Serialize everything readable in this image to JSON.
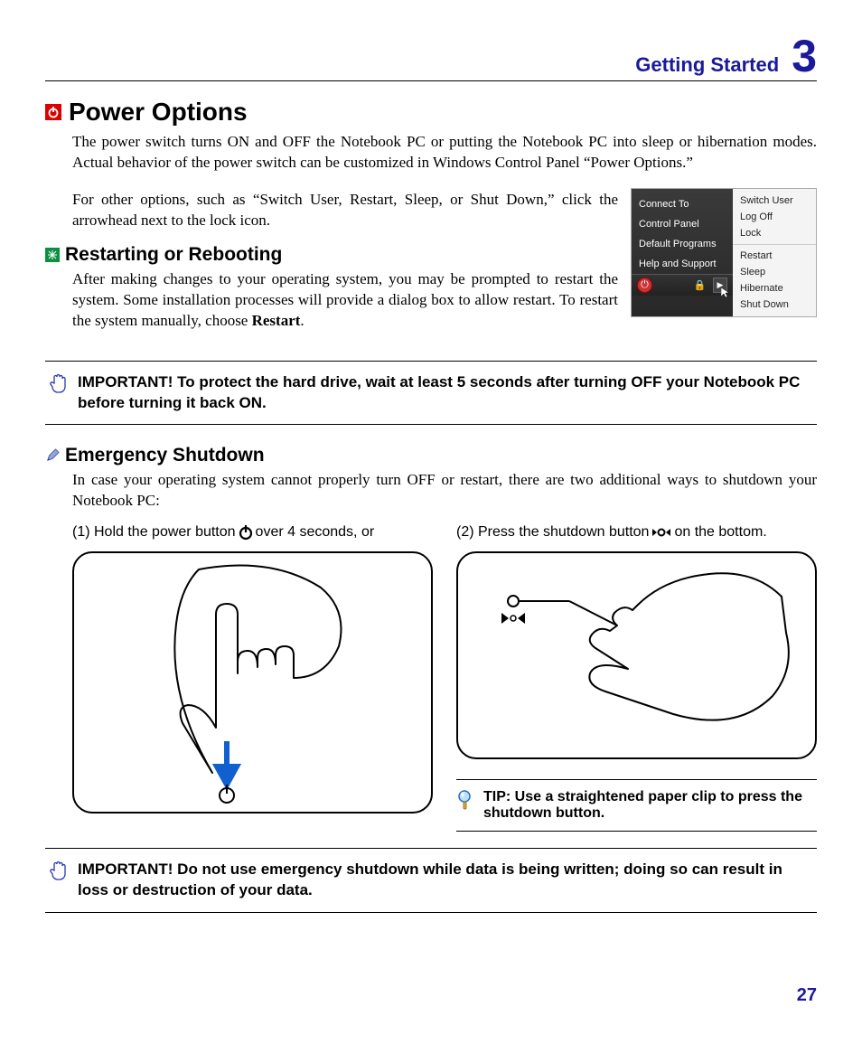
{
  "header": {
    "title": "Getting Started",
    "chapter": "3"
  },
  "h1": "Power Options",
  "p1": "The power switch turns ON and OFF the Notebook PC or putting the Notebook PC into sleep or hibernation modes. Actual behavior of the power switch can be customized in Windows Control Panel “Power Options.”",
  "p2": "For other options, such as “Switch User, Restart, Sleep, or Shut Down,” click the arrowhead next to the lock icon.",
  "menu": {
    "left": [
      "Connect To",
      "Control Panel",
      "Default Programs",
      "Help and Support"
    ],
    "right_top": [
      "Switch User",
      "Log Off",
      "Lock"
    ],
    "right_bottom": [
      "Restart",
      "Sleep",
      "Hibernate",
      "Shut Down"
    ]
  },
  "h2a": "Restarting or Rebooting",
  "p3a": "After making changes to your operating system, you may be prompted to restart the system. Some installation processes will provide a dialog box to allow restart. To restart the system manually, choose ",
  "p3b": "Restart",
  "p3c": ".",
  "callout1": "IMPORTANT!  To protect the hard drive, wait at least 5 seconds after turning OFF your Notebook PC before turning it back ON.",
  "h2b": "Emergency Shutdown",
  "p4": "In case your operating system cannot properly turn OFF or restart, there are two additional ways to shutdown your Notebook PC:",
  "cap1a": "(1) Hold the power button ",
  "cap1b": " over 4 seconds, or",
  "cap2a": "(2) Press the shutdown button ",
  "cap2b": " on the bottom.",
  "tip": "TIP: Use a straightened paper clip to press the shutdown button.",
  "callout2": "IMPORTANT!  Do not use emergency shutdown while data is being written; doing so can result in loss or destruction of your data.",
  "page": "27"
}
